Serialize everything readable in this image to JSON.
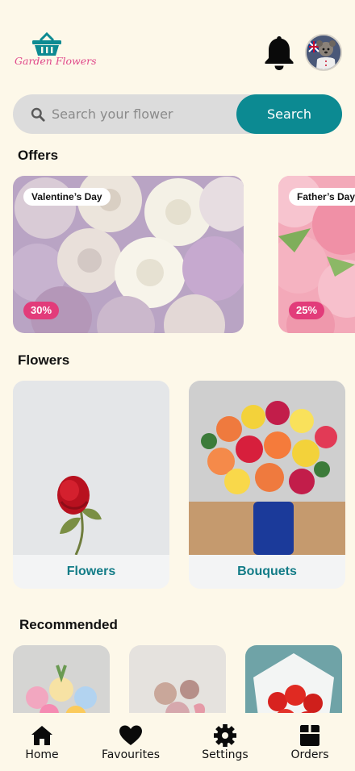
{
  "app": {
    "brand_name": "Garden Flowers",
    "brand_color": "#e0488a",
    "accent_color": "#0c8a92",
    "background_color": "#fdf8e9"
  },
  "header": {
    "notification_icon": "bell-icon",
    "avatar_icon": "user-avatar"
  },
  "search": {
    "placeholder": "Search your flower",
    "value": "",
    "button_label": "Search"
  },
  "offers": {
    "title": "Offers",
    "items": [
      {
        "name": "Valentine’s  Day",
        "discount": "30%"
      },
      {
        "name": "Father’s  Day",
        "discount": "25%"
      }
    ]
  },
  "flowers": {
    "title": "Flowers",
    "items": [
      {
        "label": "Flowers"
      },
      {
        "label": "Bouquets"
      }
    ]
  },
  "recommended": {
    "title": "Recommended"
  },
  "nav": {
    "items": [
      {
        "label": "Home",
        "icon": "home-icon"
      },
      {
        "label": "Favourites",
        "icon": "heart-icon"
      },
      {
        "label": "Settings",
        "icon": "gear-icon"
      },
      {
        "label": "Orders",
        "icon": "box-icon"
      }
    ]
  }
}
